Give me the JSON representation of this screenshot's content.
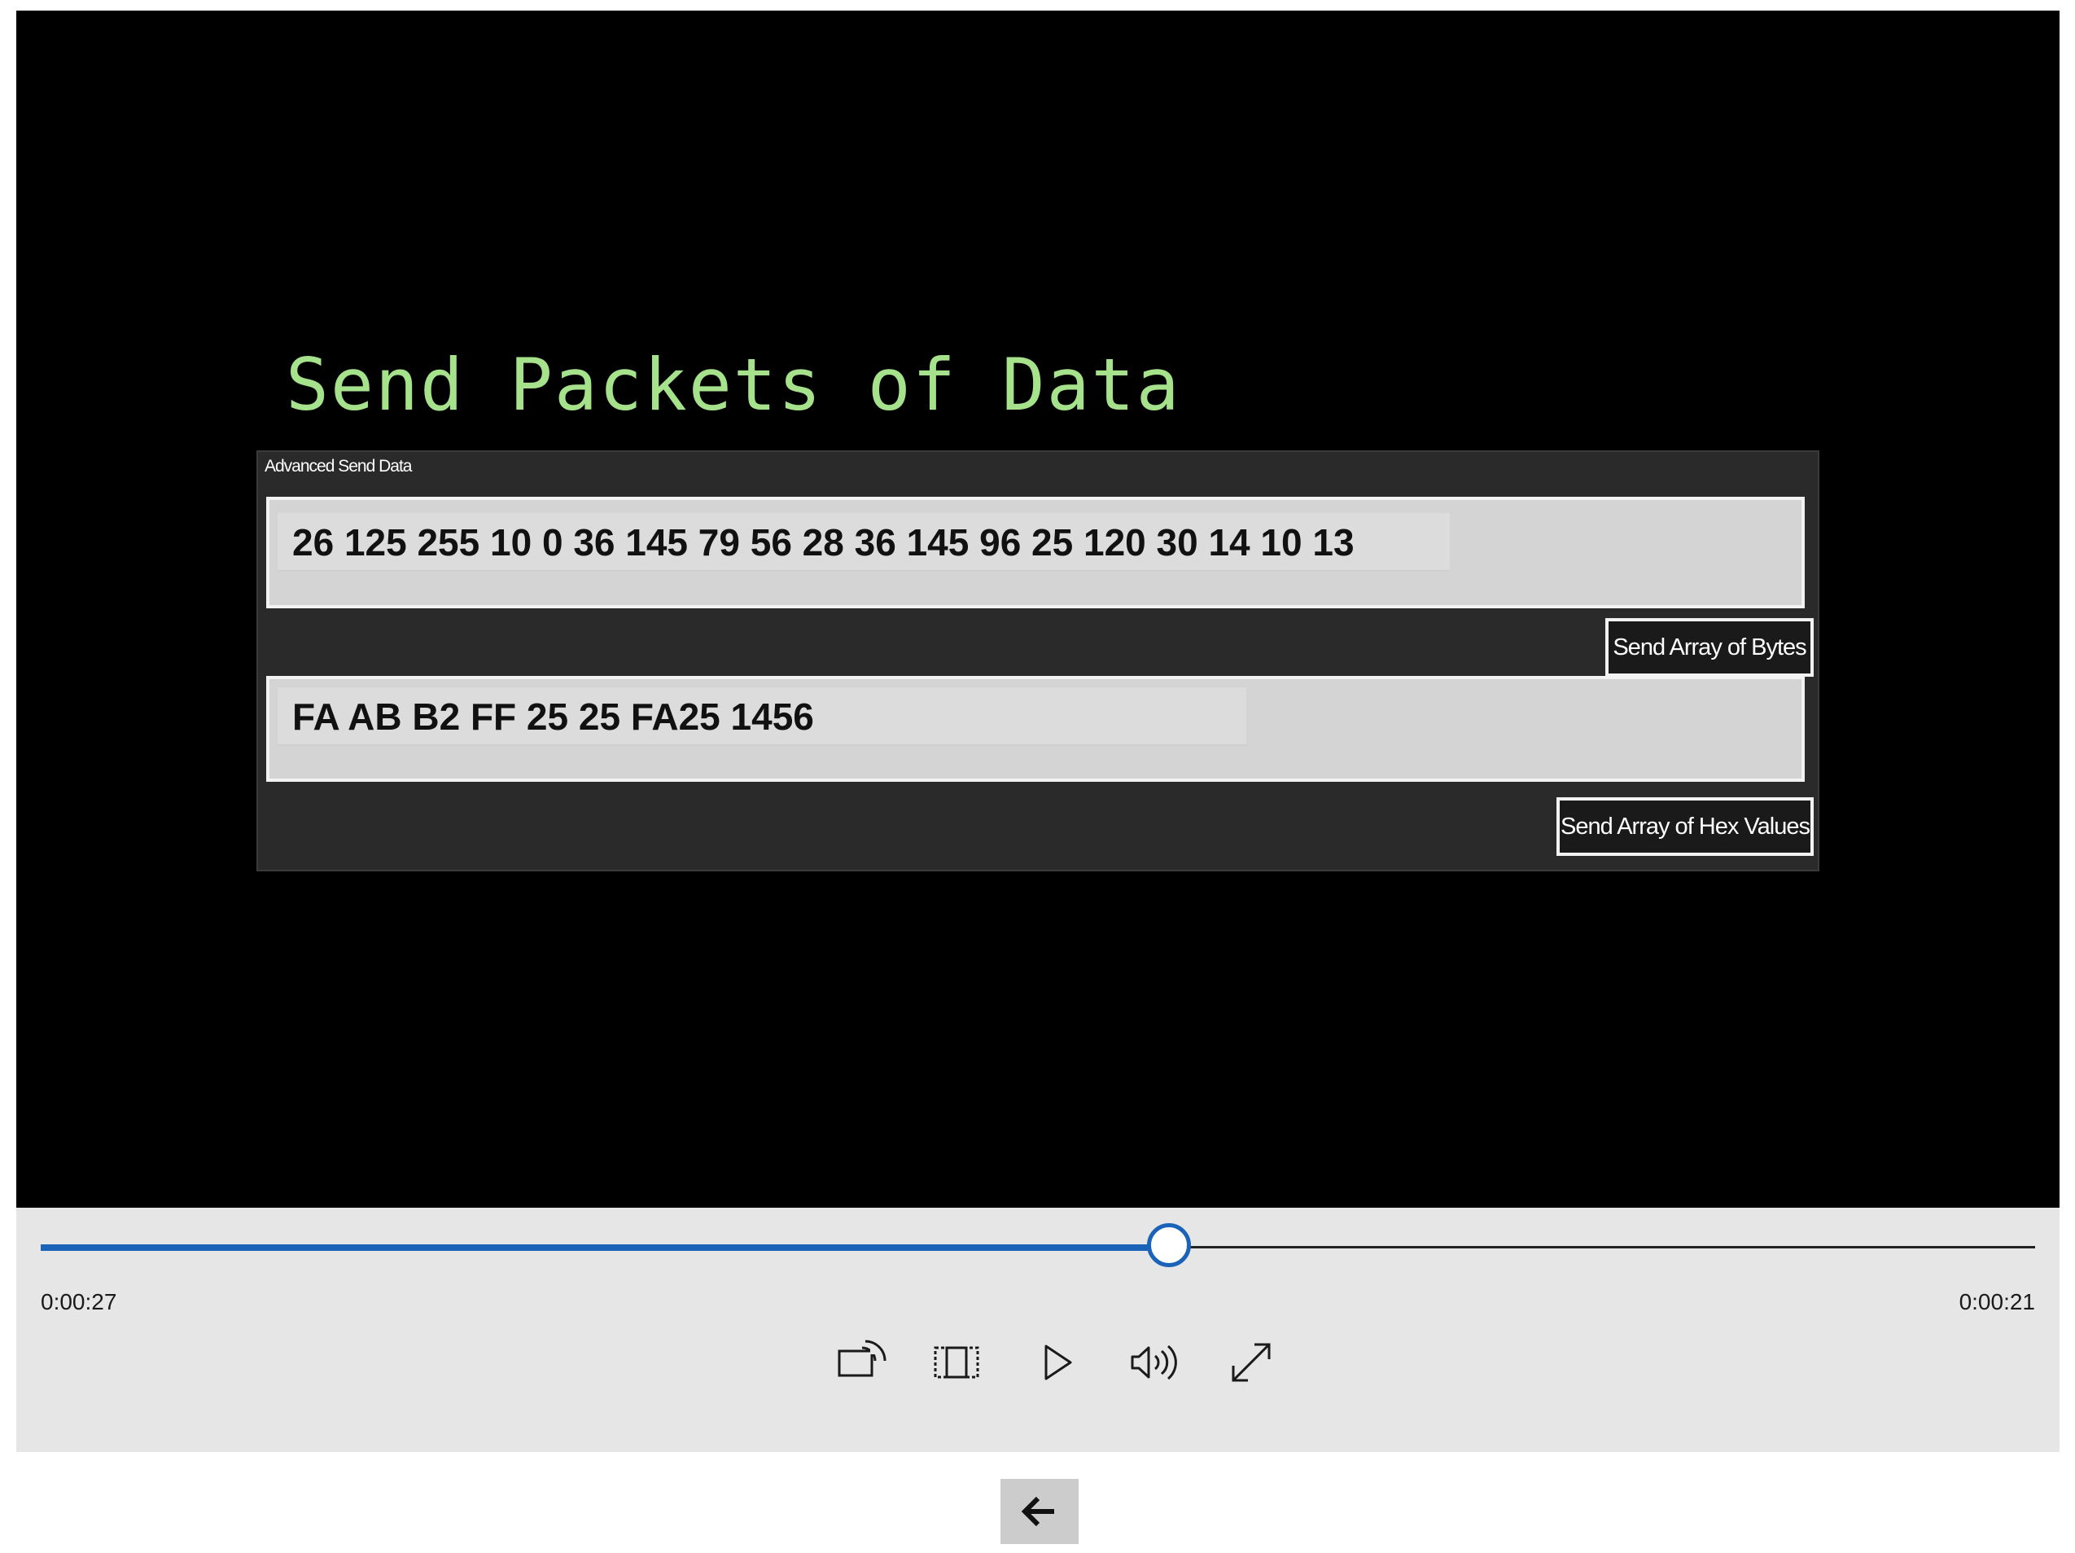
{
  "video": {
    "slide_title": "Send Packets of Data",
    "panel": {
      "label": "Advanced Send Data",
      "bytes_field_value": "26 125 255 10 0 36 145 79 56 28 36 145 96 25 120 30 14 10 13",
      "bytes_button_label": "Send Array of Bytes",
      "hex_field_value": "FA AB B2 FF 25 25 FA25 1456",
      "hex_button_label": "Send Array of Hex Values"
    },
    "colors": {
      "slide_title": "#a6e28c",
      "background": "#000000"
    }
  },
  "transport": {
    "elapsed_time": "0:00:27",
    "remaining_time": "0:00:21",
    "progress_fraction": 0.5656,
    "accent_color": "#1a63b8",
    "buttons": [
      {
        "name": "cast-to-device-button",
        "icon": "cast-icon"
      },
      {
        "name": "mini-view-button",
        "icon": "mini-view-icon"
      },
      {
        "name": "play-button",
        "icon": "play-icon"
      },
      {
        "name": "volume-button",
        "icon": "volume-icon"
      },
      {
        "name": "full-screen-button",
        "icon": "expand-icon"
      }
    ]
  },
  "navigation": {
    "back_icon": "arrow-left-icon"
  }
}
